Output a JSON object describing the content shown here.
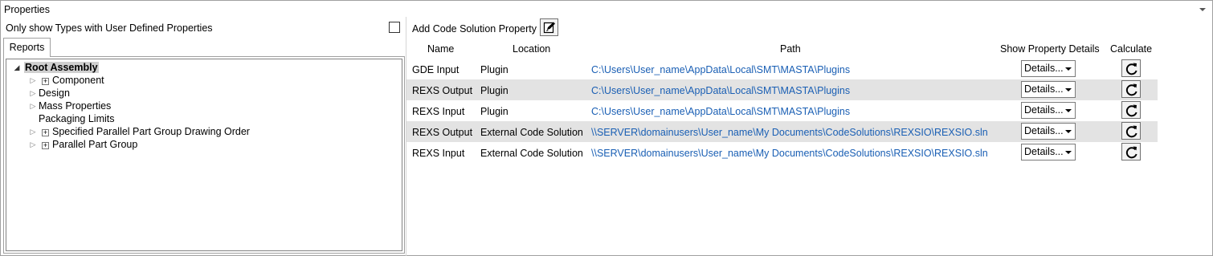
{
  "window": {
    "title": "Properties"
  },
  "left": {
    "only_show_label": "Only show Types with User Defined Properties",
    "only_show_checked": false,
    "tab_label": "Reports",
    "tree": {
      "root": "Root Assembly",
      "items": [
        {
          "label": "Component",
          "expandable": true,
          "has_plus": true
        },
        {
          "label": "Design",
          "expandable": true,
          "has_plus": false
        },
        {
          "label": "Mass Properties",
          "expandable": true,
          "has_plus": false
        },
        {
          "label": "Packaging Limits",
          "expandable": false,
          "has_plus": false
        },
        {
          "label": "Specified Parallel Part Group Drawing Order",
          "expandable": true,
          "has_plus": true
        },
        {
          "label": "Parallel Part Group",
          "expandable": true,
          "has_plus": true
        }
      ]
    }
  },
  "right": {
    "add_label": "Add Code Solution Property",
    "columns": {
      "name": "Name",
      "location": "Location",
      "path": "Path",
      "show_details": "Show Property Details",
      "calculate": "Calculate"
    },
    "rows": [
      {
        "name": "GDE Input",
        "location": "Plugin",
        "path": "C:\\Users\\User_name\\AppData\\Local\\SMT\\MASTA\\Plugins",
        "details": "Details...",
        "highlighted": false
      },
      {
        "name": "REXS Output",
        "location": "Plugin",
        "path": "C:\\Users\\User_name\\AppData\\Local\\SMT\\MASTA\\Plugins",
        "details": "Details...",
        "highlighted": true
      },
      {
        "name": "REXS Input",
        "location": "Plugin",
        "path": "C:\\Users\\User_name\\AppData\\Local\\SMT\\MASTA\\Plugins",
        "details": "Details...",
        "highlighted": false
      },
      {
        "name": "REXS Output",
        "location": "External Code Solution",
        "path": "\\\\SERVER\\domainusers\\User_name\\My Documents\\CodeSolutions\\REXSIO\\REXSIO.sln",
        "details": "Details...",
        "highlighted": true
      },
      {
        "name": "REXS Input",
        "location": "External Code Solution",
        "path": "\\\\SERVER\\domainusers\\User_name\\My Documents\\CodeSolutions\\REXSIO\\REXSIO.sln",
        "details": "Details...",
        "highlighted": false
      }
    ]
  },
  "icons": {
    "add": "edit-note-icon",
    "calculate": "refresh-icon",
    "collapse": "chevron-down-icon"
  },
  "colors": {
    "link": "#1a5fb4",
    "row_highlight": "#e3e3e3",
    "root_selection": "#cfcfcf"
  }
}
